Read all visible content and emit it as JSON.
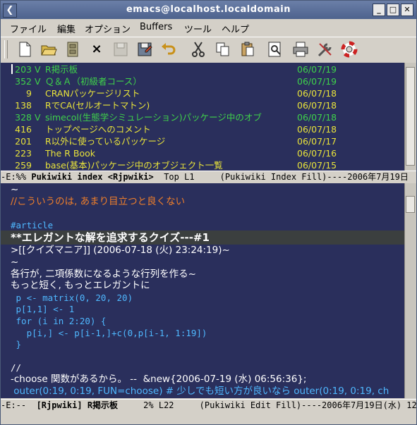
{
  "window": {
    "title": "emacs@localhost.localdomain",
    "sys_glyph": "❮",
    "min_glyph": "_",
    "max_glyph": "□",
    "close_glyph": "✕"
  },
  "colors": {
    "bg": "#2a2f5c",
    "green": "#3fd24a",
    "yellow": "#e8e33a",
    "orange": "#f07f2a",
    "cyan": "#4fb8ff",
    "white": "#ffffff"
  },
  "menu": [
    "ファイル",
    "編集",
    "オプション",
    "Buffers",
    "ツール",
    "ヘルプ"
  ],
  "toolbar": [
    "new-file-icon",
    "open-folder-icon",
    "dired-cabinet-icon",
    "close-x-icon",
    "save-disabled-icon",
    "save-as-icon",
    "undo-icon",
    "cut-icon",
    "copy-icon",
    "paste-icon",
    "search-icon",
    "print-icon",
    "tools-icon",
    "help-lifebuoy-icon"
  ],
  "close_glyph": "×",
  "index": {
    "rows": [
      {
        "num": "203",
        "flag": "V",
        "title": "R掲示板",
        "date": "06/07/19",
        "color": "green"
      },
      {
        "num": "352",
        "flag": "V",
        "title": "Ｑ＆Ａ（初級者コース）",
        "date": "06/07/19",
        "color": "green"
      },
      {
        "num": "9",
        "flag": "",
        "title": "CRANパッケージリスト",
        "date": "06/07/18",
        "color": "yellow"
      },
      {
        "num": "138",
        "flag": "",
        "title": "RでCA(セルオートマトン)",
        "date": "06/07/18",
        "color": "yellow"
      },
      {
        "num": "328",
        "flag": "V",
        "title": "simecol(生態学シミュレーション)パッケージ中のオブ",
        "date": "06/07/18",
        "color": "green"
      },
      {
        "num": "416",
        "flag": "",
        "title": "トップページへのコメント",
        "date": "06/07/18",
        "color": "yellow"
      },
      {
        "num": "201",
        "flag": "",
        "title": "R以外に使っているパッケージ",
        "date": "06/07/17",
        "color": "yellow"
      },
      {
        "num": "223",
        "flag": "",
        "title": "The R Book",
        "date": "06/07/16",
        "color": "yellow"
      },
      {
        "num": "259",
        "flag": "",
        "title": "base(基本)パッケージ中のオブジェクト一覧",
        "date": "06/07/15",
        "color": "yellow"
      }
    ],
    "modeline": {
      "pre": "-E:%% ",
      "buffer": "Pukiwiki index <Rjpwiki>",
      "post": "  Top L1     (Pukiwiki Index Fill)----2006年7月19日"
    }
  },
  "edit": {
    "lines": [
      {
        "text": "~",
        "color": "white",
        "cls": "jp"
      },
      {
        "text": "//こういうのは, あまり目立つと良くない",
        "color": "orange",
        "cls": "jp"
      },
      {
        "text": "",
        "color": "white",
        "cls": "jp"
      },
      {
        "text": "#article",
        "color": "cyan",
        "cls": ""
      },
      {
        "text": "**エレガントな解を追求するクイズ---#1",
        "color": "white",
        "cls": "heading"
      },
      {
        "text": ">[[クイズマニア]] (2006-07-18 (火) 23:24:19)~",
        "color": "white",
        "cls": "jp"
      },
      {
        "text": "~",
        "color": "white",
        "cls": "jp"
      },
      {
        "text": "各行が, 二項係数になるような行列を作る~",
        "color": "white",
        "cls": "jp"
      },
      {
        "text": "もっと短く, もっとエレガントに",
        "color": "white",
        "cls": "jp"
      },
      {
        "text": " p <- matrix(0, 20, 20)",
        "color": "cyan",
        "cls": ""
      },
      {
        "text": " p[1,1] <- 1",
        "color": "cyan",
        "cls": ""
      },
      {
        "text": " for (i in 2:20) {",
        "color": "cyan",
        "cls": ""
      },
      {
        "text": "   p[i,] <- p[i-1,]+c(0,p[i-1, 1:19])",
        "color": "cyan",
        "cls": ""
      },
      {
        "text": " }",
        "color": "cyan",
        "cls": ""
      },
      {
        "text": "",
        "color": "white",
        "cls": "jp"
      },
      {
        "text": "//",
        "color": "white",
        "cls": ""
      },
      {
        "text": "-choose 関数があるから。 --  &new{2006-07-19 (水) 06:56:36};",
        "color": "white",
        "cls": "jp"
      },
      {
        "text": " outer(0:19, 0:19, FUN=choose) # 少しでも短い方が良いなら outer(0:19, 0:19, ch",
        "color": "cyan",
        "cls": "jp"
      }
    ],
    "modeline": {
      "pre": "-E:--  ",
      "buffer": "[Rjpwiki] R掲示板",
      "post": "     2% L22     (Pukiwiki Edit Fill)----2006年7月19日(水) 12"
    }
  },
  "minibuffer": ""
}
